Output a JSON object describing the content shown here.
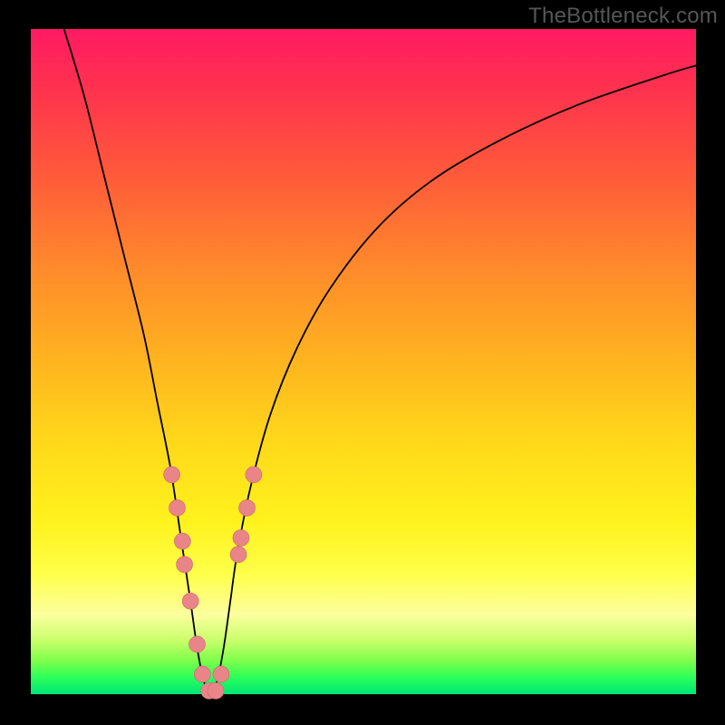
{
  "watermark": "TheBottleneck.com",
  "chart_data": {
    "type": "line",
    "title": "",
    "xlabel": "",
    "ylabel": "",
    "xlim": [
      0,
      100
    ],
    "ylim": [
      0,
      100
    ],
    "background_gradient": {
      "direction": "vertical",
      "top_color": "#ff1a63",
      "mid_colors": [
        "#ff8a2b",
        "#ffd81a",
        "#fcff9e"
      ],
      "bottom_color": "#00e676",
      "meaning": "top = high bottleneck (bad, red), bottom = balanced (good, green)"
    },
    "series": [
      {
        "name": "bottleneck-curve",
        "stroke": "#000000",
        "x": [
          5,
          8,
          11,
          14,
          17,
          19,
          21,
          22.5,
          24,
          25,
          26,
          27,
          28,
          29,
          30,
          31,
          33,
          36,
          40,
          45,
          52,
          60,
          70,
          82,
          95,
          100
        ],
        "y": [
          100,
          90,
          78,
          66,
          54,
          44,
          34,
          24,
          14,
          7,
          2,
          0,
          2,
          7,
          14,
          21,
          31,
          42,
          52,
          61,
          70,
          77,
          83,
          88.5,
          93,
          94.5
        ]
      }
    ],
    "markers": {
      "name": "highlighted-points",
      "fill": "#e98488",
      "points": [
        {
          "x": 21.2,
          "y": 33
        },
        {
          "x": 22.0,
          "y": 28
        },
        {
          "x": 22.8,
          "y": 23
        },
        {
          "x": 23.1,
          "y": 19.5
        },
        {
          "x": 24.0,
          "y": 14
        },
        {
          "x": 25.0,
          "y": 7.5
        },
        {
          "x": 25.8,
          "y": 3
        },
        {
          "x": 26.8,
          "y": 0.5
        },
        {
          "x": 27.8,
          "y": 0.5
        },
        {
          "x": 28.6,
          "y": 3
        },
        {
          "x": 31.2,
          "y": 21
        },
        {
          "x": 31.6,
          "y": 23.5
        },
        {
          "x": 32.5,
          "y": 28
        },
        {
          "x": 33.5,
          "y": 33
        }
      ]
    },
    "legend": null,
    "grid": false,
    "annotations": []
  }
}
